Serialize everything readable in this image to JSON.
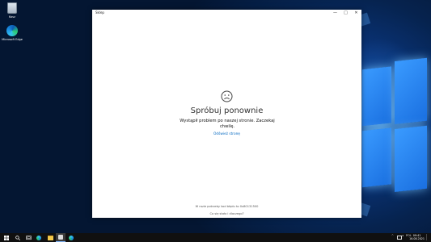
{
  "desktop": {
    "icons": [
      {
        "label": "Kosz",
        "icon": "recycle-bin-icon"
      },
      {
        "label": "Microsoft Edge",
        "icon": "edge-icon"
      }
    ]
  },
  "window": {
    "title": "Sklep",
    "controls": {
      "minimize": "—",
      "maximize": "□",
      "close": "✕"
    },
    "face_icon": "sad-face-icon",
    "heading": "Spróbuj ponownie",
    "message": "Wystąpił problem po naszej stronie. Zaczekaj chwilę.",
    "refresh_link": "Odśwież stronę",
    "error_code": "W razie potrzeby kod błędu to 0x80131500",
    "help_link": "Co się stało i dlaczego?"
  },
  "taskbar": {
    "start_icon": "windows-start-icon",
    "items": [
      "search-icon",
      "task-view-icon",
      "edge-icon",
      "file-explorer-icon",
      "store-icon",
      "edge-icon"
    ],
    "tray": {
      "chevron": "^",
      "language": "POL"
    },
    "clock": {
      "time": "09:41",
      "date": "16.08.2021"
    }
  }
}
